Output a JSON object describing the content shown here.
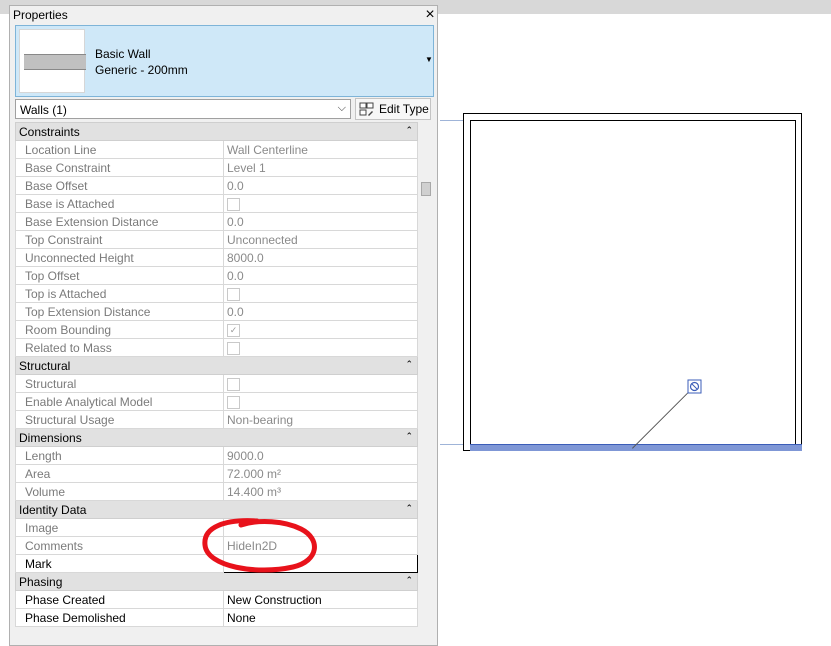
{
  "palette": {
    "title": "Properties",
    "close_glyph": "×",
    "type_selector": {
      "line1": "Basic Wall",
      "line2": "Generic - 200mm",
      "dropdown_glyph": "▼"
    },
    "instance_filter": {
      "value": "Walls (1)",
      "chevron": "⌵"
    },
    "edit_type_label": "Edit Type",
    "collapse_glyph": "⌃",
    "groups": [
      {
        "name": "Constraints",
        "rows": [
          {
            "label": "Location Line",
            "value": "Wall Centerline",
            "kind": "text"
          },
          {
            "label": "Base Constraint",
            "value": "Level 1",
            "kind": "text"
          },
          {
            "label": "Base Offset",
            "value": "0.0",
            "kind": "text"
          },
          {
            "label": "Base is Attached",
            "value": "",
            "kind": "checkbox",
            "checked": false
          },
          {
            "label": "Base Extension Distance",
            "value": "0.0",
            "kind": "text"
          },
          {
            "label": "Top Constraint",
            "value": "Unconnected",
            "kind": "text"
          },
          {
            "label": "Unconnected Height",
            "value": "8000.0",
            "kind": "text"
          },
          {
            "label": "Top Offset",
            "value": "0.0",
            "kind": "text"
          },
          {
            "label": "Top is Attached",
            "value": "",
            "kind": "checkbox",
            "checked": false
          },
          {
            "label": "Top Extension Distance",
            "value": "0.0",
            "kind": "text"
          },
          {
            "label": "Room Bounding",
            "value": "",
            "kind": "checkbox",
            "checked": true
          },
          {
            "label": "Related to Mass",
            "value": "",
            "kind": "checkbox",
            "checked": false
          }
        ]
      },
      {
        "name": "Structural",
        "rows": [
          {
            "label": "Structural",
            "value": "",
            "kind": "checkbox",
            "checked": false
          },
          {
            "label": "Enable Analytical Model",
            "value": "",
            "kind": "checkbox",
            "checked": false
          },
          {
            "label": "Structural Usage",
            "value": "Non-bearing",
            "kind": "text"
          }
        ]
      },
      {
        "name": "Dimensions",
        "rows": [
          {
            "label": "Length",
            "value": "9000.0",
            "kind": "text"
          },
          {
            "label": "Area",
            "value": "72.000 m²",
            "kind": "text"
          },
          {
            "label": "Volume",
            "value": "14.400 m³",
            "kind": "text"
          }
        ]
      },
      {
        "name": "Identity Data",
        "rows": [
          {
            "label": "Image",
            "value": "",
            "kind": "text"
          },
          {
            "label": "Comments",
            "value": "HideIn2D",
            "kind": "text"
          },
          {
            "label": "Mark",
            "value": "",
            "kind": "input",
            "editable": true
          }
        ]
      },
      {
        "name": "Phasing",
        "rows": [
          {
            "label": "Phase Created",
            "value": "New Construction",
            "kind": "text",
            "editable": true
          },
          {
            "label": "Phase Demolished",
            "value": "None",
            "kind": "text",
            "editable": true
          }
        ]
      }
    ]
  },
  "colors": {
    "selection_blue": "#7f97d6",
    "header_blue": "#cfe8f8",
    "annotation_red": "#e8121b"
  }
}
